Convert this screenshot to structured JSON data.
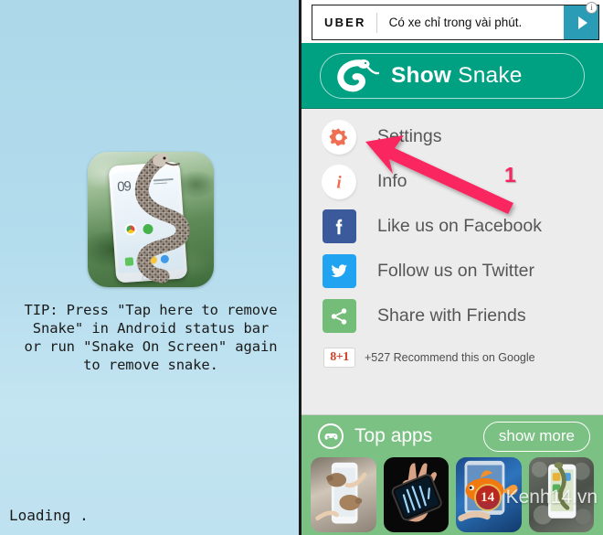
{
  "left": {
    "app_icon_name": "snake-on-screen-app-icon",
    "phone_clock": "09",
    "tip_text": "TIP: Press \"Tap here to remove\nSnake\" in Android status bar\nor run \"Snake On Screen\" again\nto remove snake.",
    "loading_text": "Loading .",
    "background_color": "#acd8e9"
  },
  "ad": {
    "brand": "UBER",
    "text": "Có xe chỉ trong vài phút.",
    "cta_icon": "play-triangle-icon",
    "info_label": "i",
    "cta_color": "#2a9cb5"
  },
  "header": {
    "title_bold": "Show",
    "title_light": " Snake",
    "logo_icon": "snake-logo-icon",
    "background_color": "#00a082"
  },
  "menu": {
    "items": [
      {
        "label": "Settings",
        "icon": "gear-icon",
        "icon_style": "circle",
        "icon_color": "#ef6f53"
      },
      {
        "label": "Info",
        "icon": "info-icon",
        "icon_style": "circle",
        "icon_color": "#ef6f53"
      },
      {
        "label": "Like us on Facebook",
        "icon": "facebook-icon",
        "icon_style": "square",
        "icon_color": "#3b5a9b"
      },
      {
        "label": "Follow us on Twitter",
        "icon": "twitter-icon",
        "icon_style": "square",
        "icon_color": "#20a3f0"
      },
      {
        "label": "Share with Friends",
        "icon": "share-icon",
        "icon_style": "square",
        "icon_color": "#73bd78"
      }
    ]
  },
  "gplus": {
    "badge": "8+1",
    "text": "+527 Recommend this on Google"
  },
  "top_apps": {
    "label": "Top apps",
    "icon": "gamepad-icon",
    "show_more_label": "show more",
    "background_color": "#7bc183",
    "thumbnails": [
      {
        "name": "mice-on-phone-app-thumbnail"
      },
      {
        "name": "xray-hand-app-thumbnail"
      },
      {
        "name": "goldfish-on-phone-app-thumbnail"
      },
      {
        "name": "lizard-on-phone-app-thumbnail"
      }
    ]
  },
  "annotation": {
    "number": "1",
    "arrow_color": "#f9255f",
    "arrow_target": "settings-menu-item"
  },
  "watermark": {
    "logo_text": "14",
    "text": "Kenh14.vn"
  }
}
